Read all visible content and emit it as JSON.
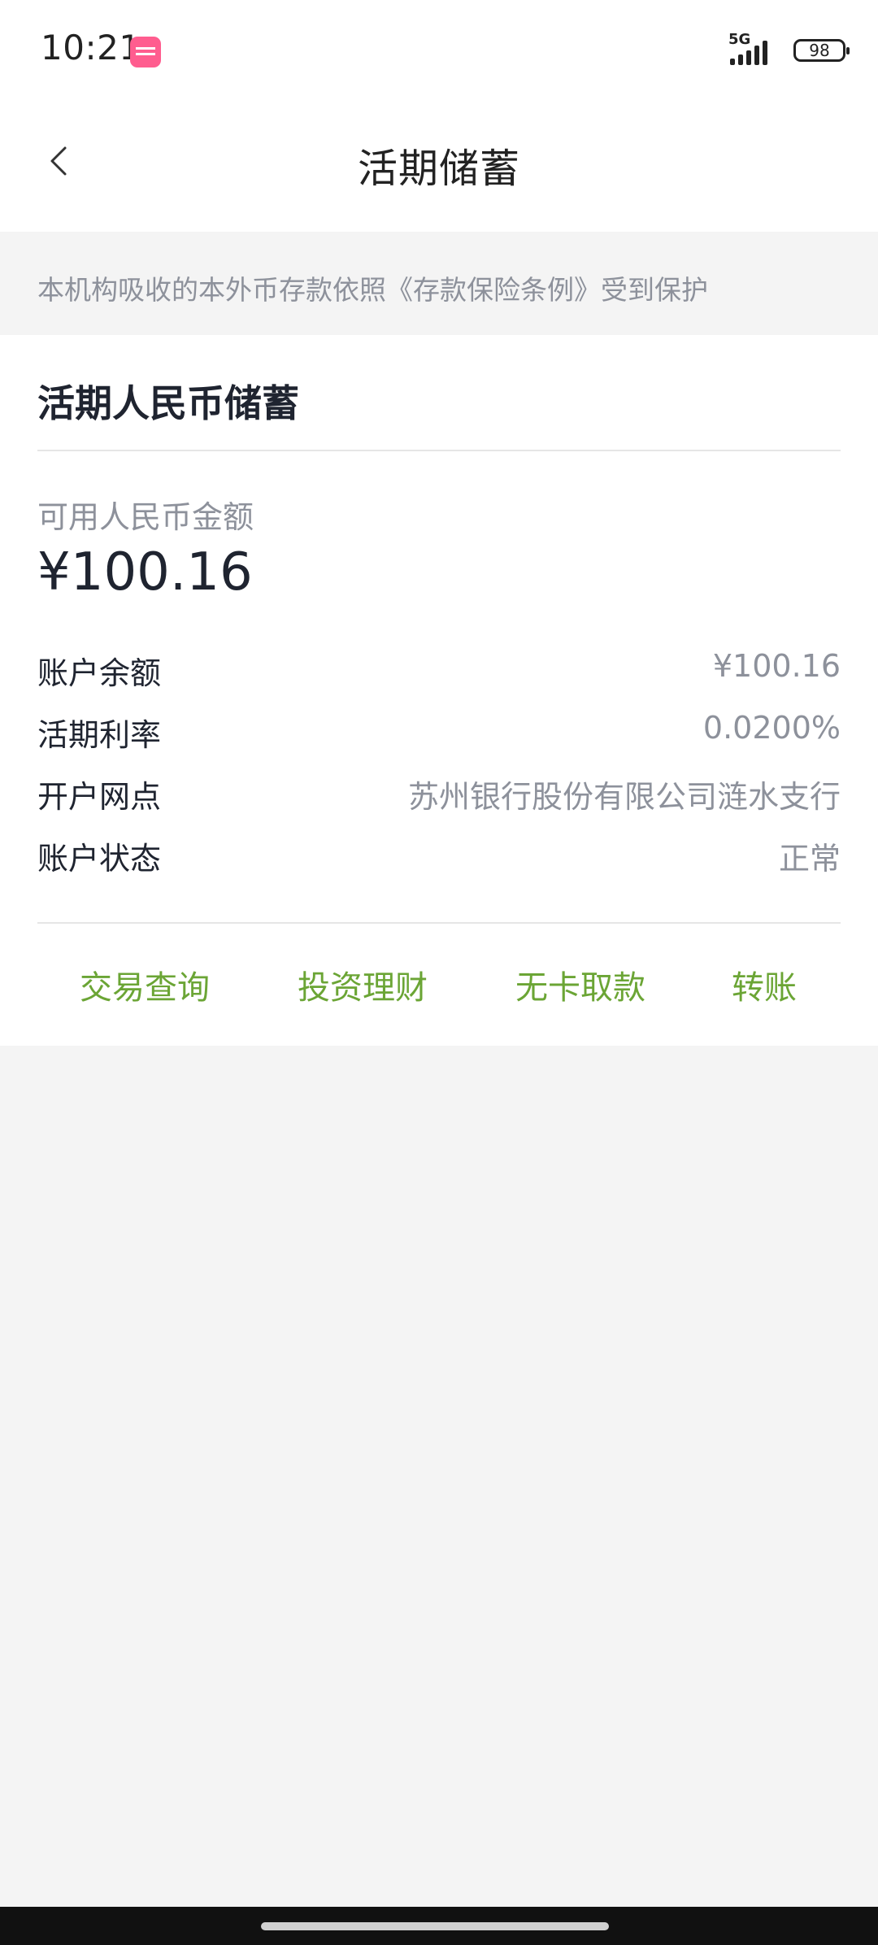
{
  "status_bar": {
    "time": "10:21",
    "network": "5G",
    "battery": "98"
  },
  "header": {
    "title": "活期储蓄"
  },
  "notice": {
    "text": "本机构吸收的本外币存款依照《存款保险条例》受到保护"
  },
  "account_card": {
    "title": "活期人民币储蓄",
    "available_label": "可用人民币金额",
    "available_amount": "¥100.16",
    "rows": [
      {
        "label": "账户余额",
        "value": "¥100.16"
      },
      {
        "label": "活期利率",
        "value": "0.0200%"
      },
      {
        "label": "开户网点",
        "value": "苏州银行股份有限公司涟水支行"
      },
      {
        "label": "账户状态",
        "value": "正常"
      }
    ]
  },
  "actions": [
    {
      "label": "交易查询"
    },
    {
      "label": "投资理财"
    },
    {
      "label": "无卡取款"
    },
    {
      "label": "转账"
    }
  ],
  "colors": {
    "action_green": "#6ba535",
    "muted_text": "#8d919b",
    "page_background": "#f4f4f4"
  }
}
